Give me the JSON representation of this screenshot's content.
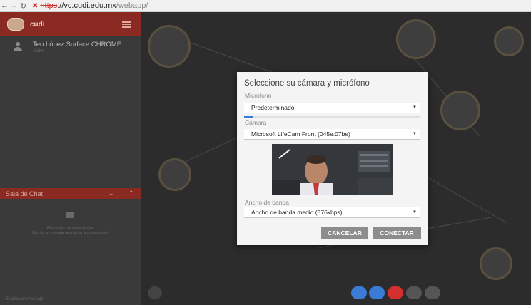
{
  "browser": {
    "url_scheme": "https",
    "url_host": "://vc.cudi.edu.mx",
    "url_path": "/webapp/"
  },
  "sidebar": {
    "title": "cudi",
    "user": {
      "name": "Teo López Surface CHROME",
      "status": "Activo"
    },
    "chat": {
      "title": "Sala de Chat",
      "empty_line1": "Aún no hay mensajes de chat",
      "empty_line2": "Escriba un mensaje para iniciar la conversación",
      "input_placeholder": "Escriba un mensaje"
    }
  },
  "modal": {
    "title": "Seleccione su cámara y micrófono",
    "mic_label": "Micrófono",
    "mic_value": "Predeterminado",
    "mic_level": 0.05,
    "camera_label": "Cámara",
    "camera_value": "Microsoft LifeCam Front (045e:07be)",
    "bandwidth_label": "Ancho de banda",
    "bandwidth_value": "Ancho de banda medio (576kbps)",
    "cancel_label": "CANCELAR",
    "connect_label": "CONECTAR"
  },
  "colors": {
    "brand": "#8a2a22",
    "accent_blue": "#3a7bd5",
    "hangup_red": "#d32f2f",
    "button_gray": "#8d8d8d"
  },
  "icons": {
    "back": "back-arrow-icon",
    "forward": "forward-arrow-icon",
    "reload": "reload-icon",
    "lock": "broken-lock-icon",
    "menu": "hamburger-menu-icon",
    "user": "user-icon",
    "chat": "chat-bubble-icon",
    "camera": "camera-icon",
    "phone": "phone-icon",
    "hangup": "hangup-icon",
    "screen": "screen-share-icon",
    "message": "message-icon"
  }
}
